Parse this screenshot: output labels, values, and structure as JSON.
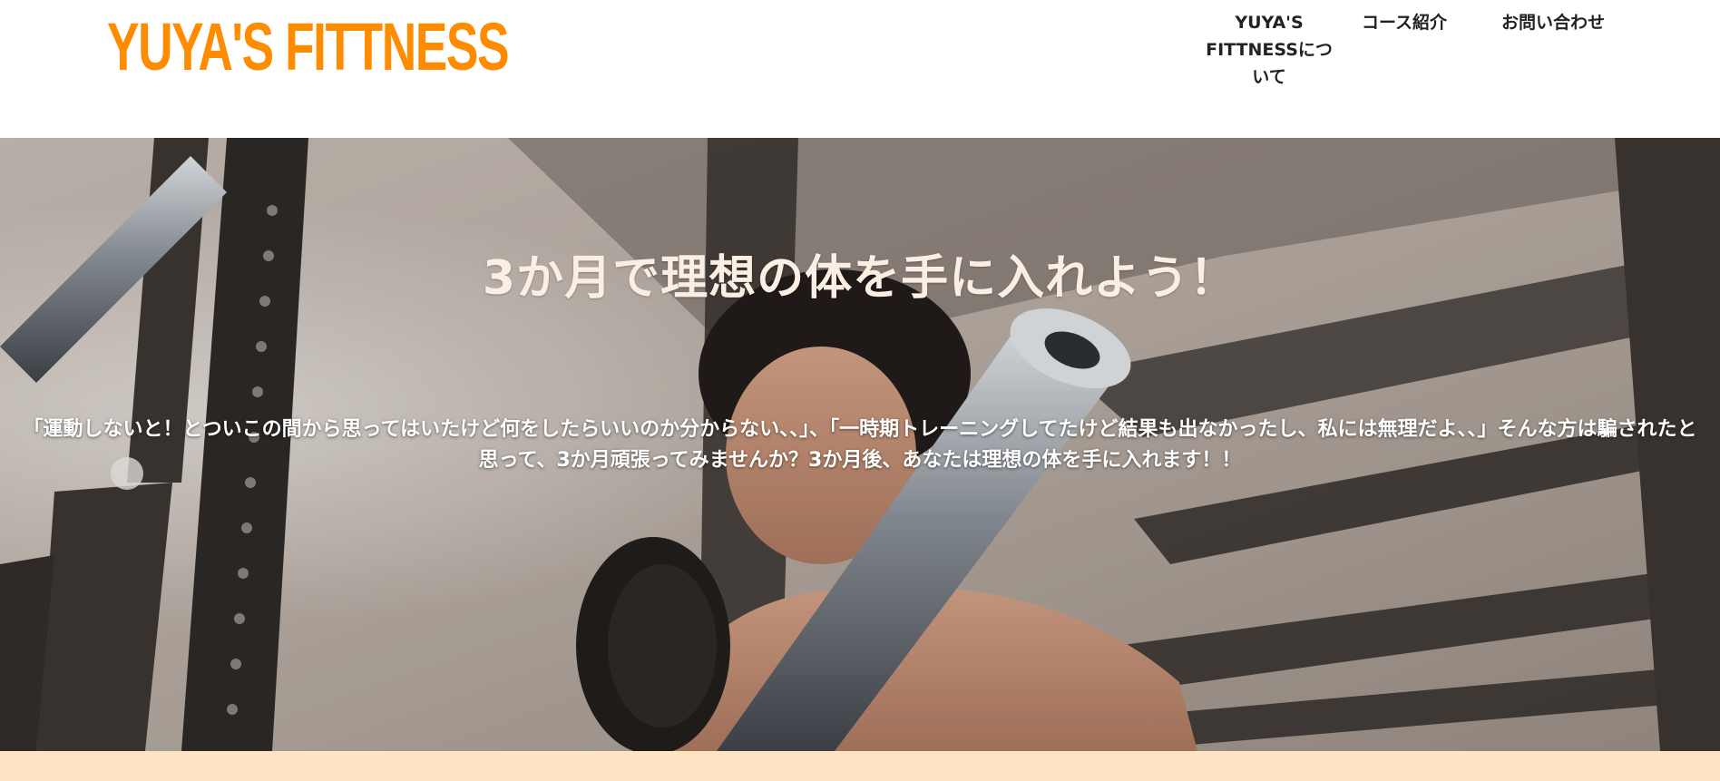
{
  "header": {
    "logo": "YUYA'S FITTNESS",
    "nav": [
      {
        "label": "YUYA'S FITTNESSについて"
      },
      {
        "label": "コース紹介"
      },
      {
        "label": "お問い合わせ"
      }
    ]
  },
  "hero": {
    "title": "3か月で理想の体を手に入れよう！",
    "text": "「運動しないと！とついこの間から思ってはいたけど何をしたらいいのか分からない、、」、「一時期トレーニングしてたけど結果も出なかったし、私には無理だよ、、」そんな方は騙されたと思って、3か月頑張ってみませんか？3か月後、あなたは理想の体を手に入れます！！",
    "image": "gym-workout-photo"
  },
  "colors": {
    "brand": "#ff8c00",
    "nav_text": "#222222",
    "hero_title": "#fbeee3",
    "hero_text": "#ffffff",
    "next_section_bg": "#ffe4c4"
  }
}
